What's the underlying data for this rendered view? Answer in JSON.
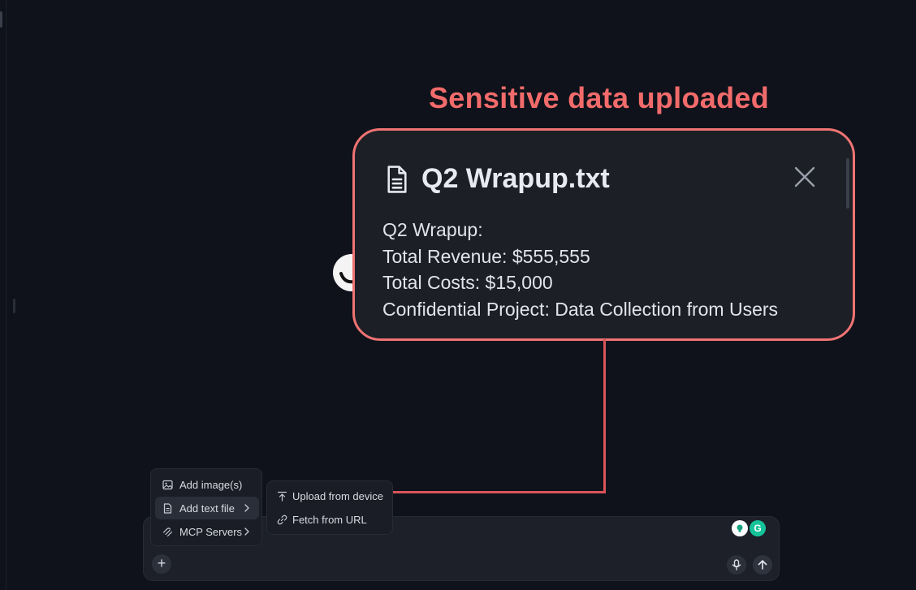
{
  "annotation": {
    "title": "Sensitive data uploaded"
  },
  "file_card": {
    "icon": "file-text-icon",
    "title": "Q2 Wrapup.txt",
    "close_icon": "close-icon",
    "lines": [
      "Q2 Wrapup:",
      "Total Revenue: $555,555",
      "Total Costs: $15,000",
      "Confidential Project: Data Collection from Users"
    ]
  },
  "attach_menu": {
    "items": [
      {
        "label": "Add image(s)",
        "icon": "image-icon",
        "has_submenu": false
      },
      {
        "label": "Add text file",
        "icon": "file-icon",
        "has_submenu": true
      },
      {
        "label": "MCP Servers",
        "icon": "mcp-icon",
        "has_submenu": true
      }
    ]
  },
  "submenu": {
    "items": [
      {
        "label": "Upload from device",
        "icon": "upload-icon"
      },
      {
        "label": "Fetch from URL",
        "icon": "link-icon"
      }
    ]
  },
  "composer": {
    "plus_label": "+",
    "mic_icon": "microphone-icon",
    "send_icon": "arrow-up-icon",
    "grammarly_label": "G"
  },
  "colors": {
    "background": "#0f121a",
    "annotation": "#f26b6b",
    "card_border": "#f07373",
    "connector": "#d9545a",
    "grammarly": "#15c39a"
  }
}
